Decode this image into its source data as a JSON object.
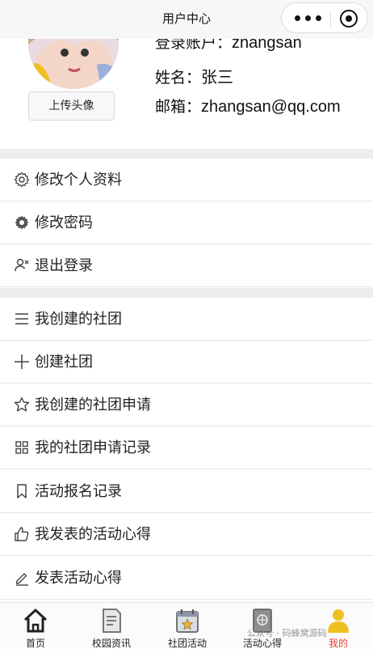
{
  "navbar": {
    "title": "用户中心"
  },
  "profile": {
    "upload_label": "上传头像",
    "account_label": "登录账户：",
    "account_value": "zhangsan",
    "name_label": "姓名：",
    "name_value": "张三",
    "email_label": "邮箱：",
    "email_value": "zhangsan@qq.com"
  },
  "menu_group1": [
    {
      "label": "修改个人资料",
      "icon": "gear-outline-icon"
    },
    {
      "label": "修改密码",
      "icon": "gear-filled-icon"
    },
    {
      "label": "退出登录",
      "icon": "user-logout-icon"
    }
  ],
  "menu_group2": [
    {
      "label": "我创建的社团",
      "icon": "list-lines-icon"
    },
    {
      "label": "创建社团",
      "icon": "plus-icon"
    },
    {
      "label": "我创建的社团申请",
      "icon": "star-outline-icon"
    },
    {
      "label": "我的社团申请记录",
      "icon": "grid-icon"
    },
    {
      "label": "活动报名记录",
      "icon": "bookmark-icon"
    },
    {
      "label": "我发表的活动心得",
      "icon": "thumbs-up-icon"
    },
    {
      "label": "发表活动心得",
      "icon": "edit-pen-icon"
    }
  ],
  "tabbar": [
    {
      "label": "首页",
      "icon": "home-icon"
    },
    {
      "label": "校园资讯",
      "icon": "document-icon"
    },
    {
      "label": "社团活动",
      "icon": "calendar-star-icon"
    },
    {
      "label": "活动心得",
      "icon": "notebook-globe-icon"
    },
    {
      "label": "我的",
      "icon": "person-icon",
      "active": true
    }
  ],
  "watermark": "公众号 · 码蜂窝源码",
  "colors": {
    "active_tab": "#e64340",
    "divider": "#ededed",
    "avatar_accent": "#f0c020"
  }
}
